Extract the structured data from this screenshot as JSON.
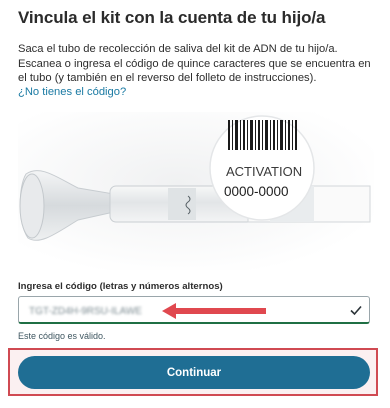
{
  "page": {
    "title": "Vincula el kit con la cuenta de tu hijo/a",
    "instructions": "Saca el tubo de recolección de saliva del kit de ADN de tu hijo/a. Escanea o ingresa el código de quince caracteres que se encuentra en el tubo (y también en el reverso del folleto de instrucciones).",
    "help_link": "¿No tienes el código?"
  },
  "illustration": {
    "activation_label": "ACTIVATION",
    "activation_code": "0000-0000"
  },
  "form": {
    "code_label": "Ingresa el código (letras y números alternos)",
    "code_value": "TGT-ZD4H-9RSU-ILAWE",
    "valid_message": "Este código es válido.",
    "valid_color": "#1f6f44"
  },
  "actions": {
    "continue_label": "Continuar",
    "button_color": "#1f6e94",
    "highlight_color": "#d04a52"
  }
}
